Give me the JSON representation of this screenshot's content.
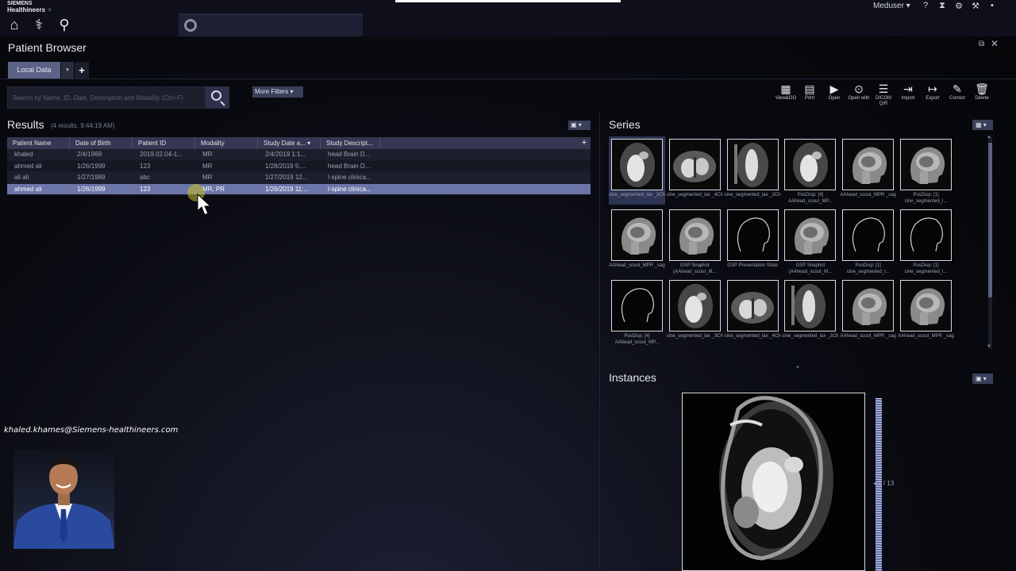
{
  "app": {
    "brand_line1": "SIEMENS",
    "brand_line2": "Healthineers",
    "user": "Meduser"
  },
  "patient_browser": {
    "title": "Patient Browser",
    "tab_local": "Local Data",
    "search_placeholder": "Search by Name, ID, Date, Description and Modality (Ctrl+F)",
    "more_filters": "More Filters"
  },
  "toolbar": [
    {
      "label": "View&GO",
      "icon": "view-go-icon"
    },
    {
      "label": "Print",
      "icon": "print-icon"
    },
    {
      "label": "Open",
      "icon": "play-icon"
    },
    {
      "label": "Open with",
      "icon": "open-with-icon"
    },
    {
      "label": "DICOM Q/R",
      "icon": "dicom-qr-icon"
    },
    {
      "label": "Import",
      "icon": "import-icon"
    },
    {
      "label": "Export",
      "icon": "export-icon"
    },
    {
      "label": "Correct",
      "icon": "correct-icon"
    },
    {
      "label": "Delete",
      "icon": "trash-icon"
    }
  ],
  "results": {
    "title": "Results",
    "meta": "(4 results, 9:44:19 AM)",
    "columns": [
      "Patient Name",
      "Date of Birth",
      "Patient ID",
      "Modality",
      "Study Date a...",
      "Study Descript..."
    ],
    "rows": [
      [
        "khaled",
        "2/4/1969",
        "2019.02.04-1...",
        "MR",
        "2/4/2019 1:1...",
        "head Brain D..."
      ],
      [
        "ahmed ali",
        "1/26/1999",
        "123",
        "MR",
        "1/28/2019 5:...",
        "head Brain D..."
      ],
      [
        "ali ali",
        "1/27/1989",
        "abc",
        "MR",
        "1/27/2019 12...",
        "l-spine clinica..."
      ],
      [
        "ahmed ali",
        "1/26/1999",
        "123",
        "MR, PR",
        "1/26/2019 11:...",
        "l-spine clinica..."
      ]
    ],
    "selected_row": 3
  },
  "series": {
    "title": "Series",
    "thumbs": [
      {
        "label": "cine_segmented_lax _3Ch",
        "kind": "heart-sag"
      },
      {
        "label": "cine_segmented_lax _4Ch",
        "kind": "heart-4ch"
      },
      {
        "label": "cine_segmented_lax _2Ch",
        "kind": "heart-2ch"
      },
      {
        "label": "PosDisp: [4] AAhead_scout_MP...",
        "kind": "heart-sag"
      },
      {
        "label": "AAhead_scout_MPR _sag",
        "kind": "head"
      },
      {
        "label": "PosDisp: [1] cine_segmented_l...",
        "kind": "head"
      },
      {
        "label": "AAhead_scout_MPR _sag",
        "kind": "head"
      },
      {
        "label": "GSP Snaphot (AAhead_scout_M...",
        "kind": "head"
      },
      {
        "label": "GSP Presentation State",
        "kind": "outline"
      },
      {
        "label": "GSP Snaphot (AAhead_scout_M...",
        "kind": "head"
      },
      {
        "label": "PosDisp: [1] cine_segmented_l...",
        "kind": "outline"
      },
      {
        "label": "PosDisp: [1] cine_segmented_l...",
        "kind": "outline"
      },
      {
        "label": "PosDisp: [4] AAhead_scout_MP...",
        "kind": "outline"
      },
      {
        "label": "cine_segmented_lax _3Ch",
        "kind": "heart-sag"
      },
      {
        "label": "cine_segmented_lax _4Ch",
        "kind": "heart-4ch"
      },
      {
        "label": "cine_segmented_lax _2Ch",
        "kind": "heart-2ch"
      },
      {
        "label": "AAhead_scout_MPR _sag",
        "kind": "head"
      },
      {
        "label": "AAhead_scout_MPR _sag",
        "kind": "head"
      }
    ]
  },
  "instances": {
    "title": "Instances",
    "counter": "1 / 13"
  },
  "overlay": {
    "email": "khaled.khames@Siemens-healthineers.com"
  }
}
